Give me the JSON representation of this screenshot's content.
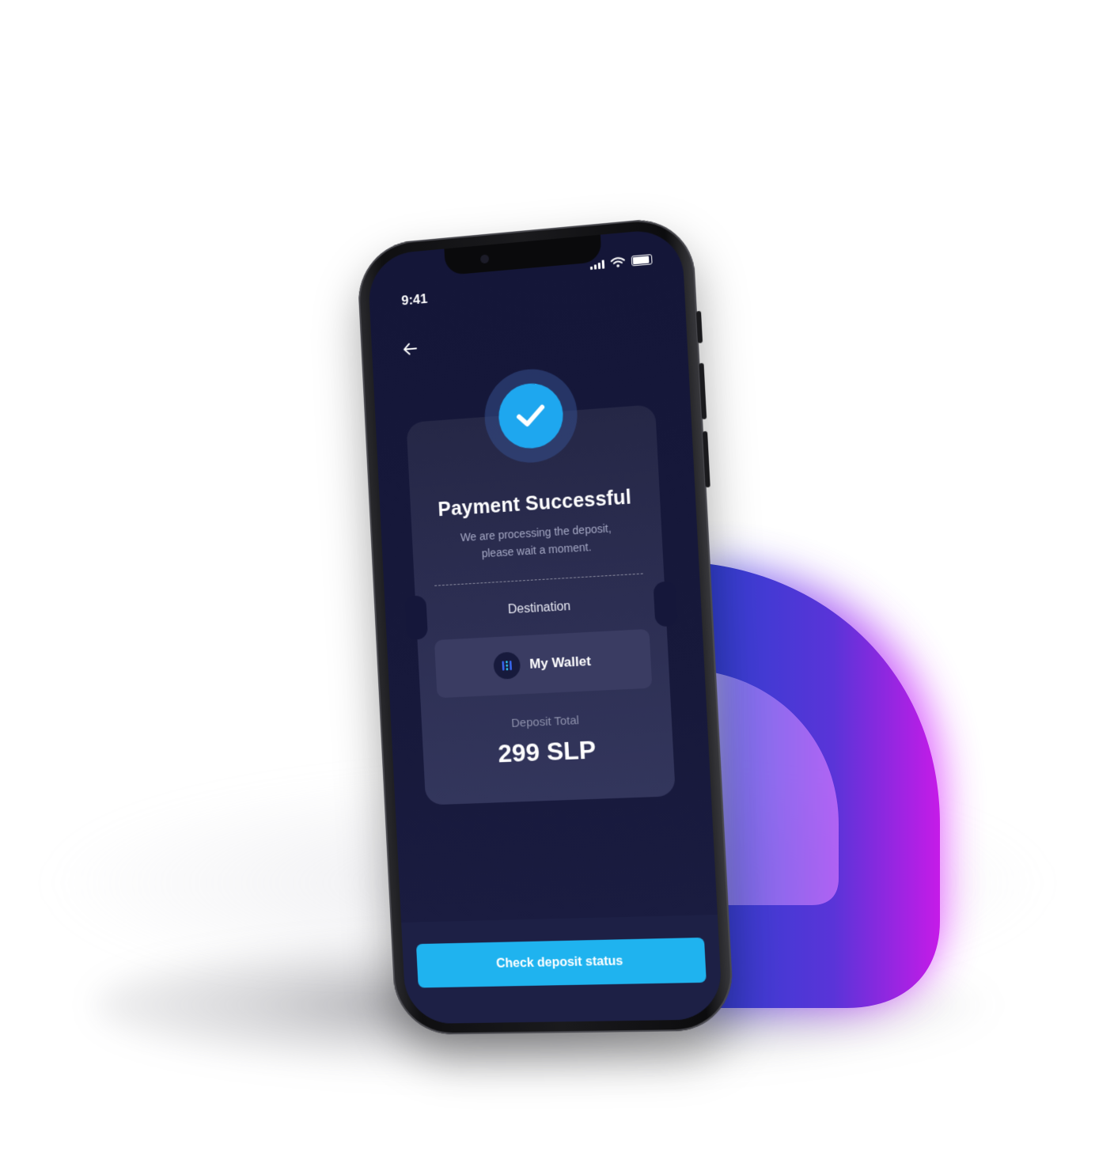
{
  "status_bar": {
    "time": "9:41",
    "signal_icon": "cellular-signal-icon",
    "wifi_icon": "wifi-icon",
    "battery_icon": "battery-icon"
  },
  "nav": {
    "back_icon": "arrow-left-icon"
  },
  "receipt": {
    "status_icon": "check-icon",
    "title": "Payment Successful",
    "message_line1": "We are processing the deposit,",
    "message_line2": "please wait a moment.",
    "destination_label": "Destination",
    "wallet": {
      "icon": "wallet-logo-icon",
      "name": "My Wallet"
    },
    "total_label": "Deposit Total",
    "total_value": "299 SLP"
  },
  "actions": {
    "primary_label": "Check deposit status"
  },
  "colors": {
    "screen_bg": "#141638",
    "accent": "#1fb3ef",
    "check": "#1ea7ef",
    "d_shape_start": "#2f3fd0",
    "d_shape_end": "#c61be8"
  }
}
